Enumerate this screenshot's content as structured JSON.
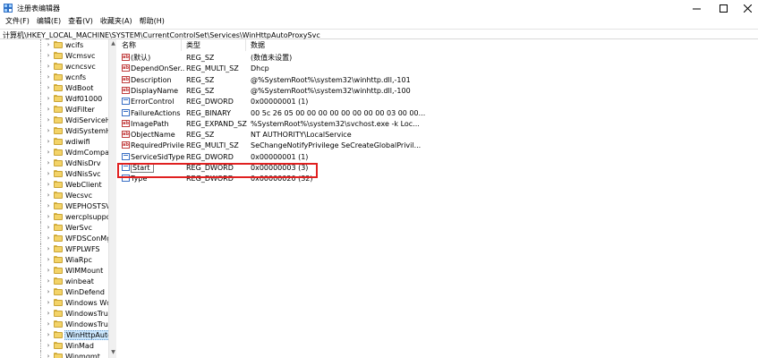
{
  "window": {
    "title": "注册表编辑器",
    "controls": {
      "minimize": "—",
      "maximize": "☐",
      "close": "✕"
    }
  },
  "menu": [
    "文件(F)",
    "编辑(E)",
    "查看(V)",
    "收藏夹(A)",
    "帮助(H)"
  ],
  "address": "计算机\\HKEY_LOCAL_MACHINE\\SYSTEM\\CurrentControlSet\\Services\\WinHttpAutoProxySvc",
  "tree": {
    "items": [
      "wcifs",
      "Wcmsvc",
      "wcncsvc",
      "wcnfs",
      "WdBoot",
      "Wdf01000",
      "WdFilter",
      "WdiServiceHo",
      "WdiSystemHo",
      "wdiwifi",
      "WdmCompan",
      "WdNisDrv",
      "WdNisSvc",
      "WebClient",
      "Wecsvc",
      "WEPHOSTSVC",
      "wercplsuppo",
      "WerSvc",
      "WFDSConMg",
      "WFPLWFS",
      "WiaRpc",
      "WIMMount",
      "winbeat",
      "WinDefend",
      "Windows Wc",
      "WindowsTrus",
      "WindowsTrus",
      "WinHttpAuto",
      "WinMad",
      "Winmgmt"
    ],
    "selected_index": 27,
    "expander_glyph": "›"
  },
  "list": {
    "columns": {
      "name": "名称",
      "type": "类型",
      "data": "数据"
    },
    "rows": [
      {
        "icon": "string-value-icon",
        "icon_text": "ab",
        "name": "(默认)",
        "type": "REG_SZ",
        "data": "(数值未设置)"
      },
      {
        "icon": "string-value-icon",
        "icon_text": "ab",
        "name": "DependOnSer...",
        "type": "REG_MULTI_SZ",
        "data": "Dhcp"
      },
      {
        "icon": "string-value-icon",
        "icon_text": "ab",
        "name": "Description",
        "type": "REG_SZ",
        "data": "@%SystemRoot%\\system32\\winhttp.dll,-101"
      },
      {
        "icon": "string-value-icon",
        "icon_text": "ab",
        "name": "DisplayName",
        "type": "REG_SZ",
        "data": "@%SystemRoot%\\system32\\winhttp.dll,-100"
      },
      {
        "icon": "binary-value-icon",
        "icon_text": "",
        "name": "ErrorControl",
        "type": "REG_DWORD",
        "data": "0x00000001 (1)"
      },
      {
        "icon": "binary-value-icon",
        "icon_text": "",
        "name": "FailureActions",
        "type": "REG_BINARY",
        "data": "00 5c 26 05 00 00 00 00 00 00 00 00 03 00 00..."
      },
      {
        "icon": "string-value-icon",
        "icon_text": "ab",
        "name": "ImagePath",
        "type": "REG_EXPAND_SZ",
        "data": "%SystemRoot%\\system32\\svchost.exe -k Loc..."
      },
      {
        "icon": "string-value-icon",
        "icon_text": "ab",
        "name": "ObjectName",
        "type": "REG_SZ",
        "data": "NT AUTHORITY\\LocalService"
      },
      {
        "icon": "string-value-icon",
        "icon_text": "ab",
        "name": "RequiredPrivile...",
        "type": "REG_MULTI_SZ",
        "data": "SeChangeNotifyPrivilege SeCreateGlobalPrivil..."
      },
      {
        "icon": "binary-value-icon",
        "icon_text": "",
        "name": "ServiceSidType",
        "type": "REG_DWORD",
        "data": "0x00000001 (1)"
      },
      {
        "icon": "binary-value-icon",
        "icon_text": "",
        "name": "Start",
        "type": "REG_DWORD",
        "data": "0x00000003 (3)"
      },
      {
        "icon": "binary-value-icon",
        "icon_text": "",
        "name": "Type",
        "type": "REG_DWORD",
        "data": "0x00000020 (32)"
      }
    ],
    "focused_index": 10
  },
  "colors": {
    "highlight": "#e02020",
    "selection": "#cce8ff"
  }
}
